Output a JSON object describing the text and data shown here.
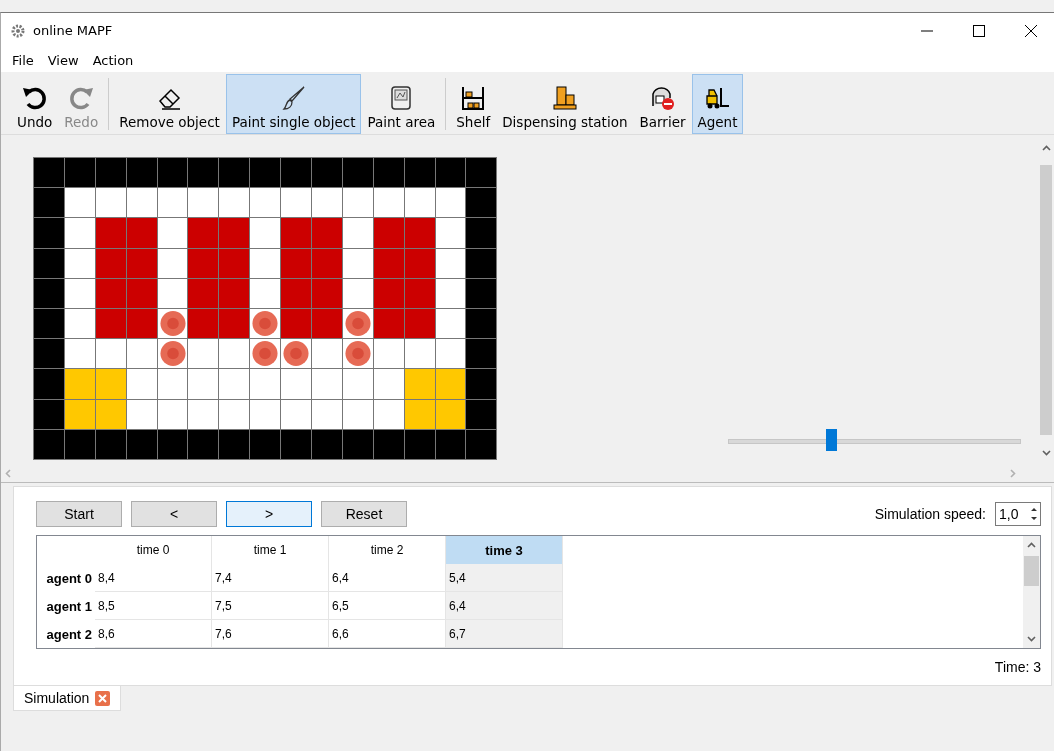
{
  "window": {
    "title": "online MAPF"
  },
  "menu": [
    "File",
    "View",
    "Action"
  ],
  "toolbar": [
    {
      "label": "Undo",
      "selected": false,
      "disabled": false
    },
    {
      "label": "Redo",
      "selected": false,
      "disabled": true
    },
    {
      "label": "Remove object",
      "selected": false,
      "disabled": false
    },
    {
      "label": "Paint single object",
      "selected": true,
      "disabled": false
    },
    {
      "label": "Paint area",
      "selected": false,
      "disabled": false
    },
    {
      "label": "Shelf",
      "selected": false,
      "disabled": false
    },
    {
      "label": "Dispensing station",
      "selected": false,
      "disabled": false
    },
    {
      "label": "Barrier",
      "selected": false,
      "disabled": false
    },
    {
      "label": "Agent",
      "selected": true,
      "disabled": false
    }
  ],
  "map": {
    "cells": [
      [
        {
          "kind": "barrier"
        },
        {
          "kind": "barrier"
        },
        {
          "kind": "barrier"
        },
        {
          "kind": "barrier"
        },
        {
          "kind": "barrier"
        },
        {
          "kind": "barrier"
        },
        {
          "kind": "barrier"
        },
        {
          "kind": "barrier"
        },
        {
          "kind": "barrier"
        },
        {
          "kind": "barrier"
        },
        {
          "kind": "barrier"
        },
        {
          "kind": "barrier"
        },
        {
          "kind": "barrier"
        },
        {
          "kind": "barrier"
        },
        {
          "kind": "barrier"
        }
      ],
      [
        {
          "kind": "barrier"
        },
        {
          "kind": "floor"
        },
        {
          "kind": "floor"
        },
        {
          "kind": "floor"
        },
        {
          "kind": "floor"
        },
        {
          "kind": "floor"
        },
        {
          "kind": "floor"
        },
        {
          "kind": "floor"
        },
        {
          "kind": "floor"
        },
        {
          "kind": "floor"
        },
        {
          "kind": "floor"
        },
        {
          "kind": "floor"
        },
        {
          "kind": "floor"
        },
        {
          "kind": "floor"
        },
        {
          "kind": "barrier"
        }
      ],
      [
        {
          "kind": "barrier"
        },
        {
          "kind": "floor"
        },
        {
          "kind": "shelf"
        },
        {
          "kind": "shelf"
        },
        {
          "kind": "floor"
        },
        {
          "kind": "shelf"
        },
        {
          "kind": "shelf"
        },
        {
          "kind": "floor"
        },
        {
          "kind": "shelf"
        },
        {
          "kind": "shelf"
        },
        {
          "kind": "floor"
        },
        {
          "kind": "shelf"
        },
        {
          "kind": "shelf"
        },
        {
          "kind": "floor"
        },
        {
          "kind": "barrier"
        }
      ],
      [
        {
          "kind": "barrier"
        },
        {
          "kind": "floor"
        },
        {
          "kind": "shelf"
        },
        {
          "kind": "shelf"
        },
        {
          "kind": "floor"
        },
        {
          "kind": "shelf"
        },
        {
          "kind": "shelf"
        },
        {
          "kind": "floor"
        },
        {
          "kind": "shelf"
        },
        {
          "kind": "shelf"
        },
        {
          "kind": "floor"
        },
        {
          "kind": "shelf"
        },
        {
          "kind": "shelf"
        },
        {
          "kind": "floor"
        },
        {
          "kind": "barrier"
        }
      ],
      [
        {
          "kind": "barrier"
        },
        {
          "kind": "floor"
        },
        {
          "kind": "shelf"
        },
        {
          "kind": "shelf"
        },
        {
          "kind": "floor"
        },
        {
          "kind": "shelf"
        },
        {
          "kind": "shelf"
        },
        {
          "kind": "floor"
        },
        {
          "kind": "shelf"
        },
        {
          "kind": "shelf"
        },
        {
          "kind": "floor"
        },
        {
          "kind": "shelf"
        },
        {
          "kind": "shelf"
        },
        {
          "kind": "floor"
        },
        {
          "kind": "barrier"
        }
      ],
      [
        {
          "kind": "barrier"
        },
        {
          "kind": "floor"
        },
        {
          "kind": "shelf"
        },
        {
          "kind": "shelf"
        },
        {
          "kind": "agent"
        },
        {
          "kind": "shelf"
        },
        {
          "kind": "shelf"
        },
        {
          "kind": "agent"
        },
        {
          "kind": "shelf"
        },
        {
          "kind": "shelf"
        },
        {
          "kind": "agent"
        },
        {
          "kind": "shelf"
        },
        {
          "kind": "shelf"
        },
        {
          "kind": "floor"
        },
        {
          "kind": "barrier"
        }
      ],
      [
        {
          "kind": "barrier"
        },
        {
          "kind": "floor"
        },
        {
          "kind": "floor"
        },
        {
          "kind": "floor"
        },
        {
          "kind": "agent"
        },
        {
          "kind": "floor"
        },
        {
          "kind": "floor"
        },
        {
          "kind": "agent"
        },
        {
          "kind": "agent"
        },
        {
          "kind": "floor"
        },
        {
          "kind": "agent"
        },
        {
          "kind": "floor"
        },
        {
          "kind": "floor"
        },
        {
          "kind": "floor"
        },
        {
          "kind": "barrier"
        }
      ],
      [
        {
          "kind": "barrier"
        },
        {
          "kind": "station"
        },
        {
          "kind": "station"
        },
        {
          "kind": "floor"
        },
        {
          "kind": "floor"
        },
        {
          "kind": "floor"
        },
        {
          "kind": "floor"
        },
        {
          "kind": "floor"
        },
        {
          "kind": "floor"
        },
        {
          "kind": "floor"
        },
        {
          "kind": "floor"
        },
        {
          "kind": "floor"
        },
        {
          "kind": "station"
        },
        {
          "kind": "station"
        },
        {
          "kind": "barrier"
        }
      ],
      [
        {
          "kind": "barrier"
        },
        {
          "kind": "station"
        },
        {
          "kind": "station"
        },
        {
          "kind": "floor"
        },
        {
          "kind": "floor"
        },
        {
          "kind": "floor"
        },
        {
          "kind": "floor"
        },
        {
          "kind": "floor"
        },
        {
          "kind": "floor"
        },
        {
          "kind": "floor"
        },
        {
          "kind": "floor"
        },
        {
          "kind": "floor"
        },
        {
          "kind": "station"
        },
        {
          "kind": "station"
        },
        {
          "kind": "barrier"
        }
      ],
      [
        {
          "kind": "barrier"
        },
        {
          "kind": "barrier"
        },
        {
          "kind": "barrier"
        },
        {
          "kind": "barrier"
        },
        {
          "kind": "barrier"
        },
        {
          "kind": "barrier"
        },
        {
          "kind": "barrier"
        },
        {
          "kind": "barrier"
        },
        {
          "kind": "barrier"
        },
        {
          "kind": "barrier"
        },
        {
          "kind": "barrier"
        },
        {
          "kind": "barrier"
        },
        {
          "kind": "barrier"
        },
        {
          "kind": "barrier"
        },
        {
          "kind": "barrier"
        }
      ]
    ],
    "zoom": {
      "level": 0.35
    }
  },
  "controls": [
    {
      "label": "Start",
      "focused": false
    },
    {
      "label": "<",
      "focused": false
    },
    {
      "label": ">",
      "focused": true
    },
    {
      "label": "Reset",
      "focused": false
    }
  ],
  "speed": {
    "label": "Simulation speed:",
    "value": "1,0"
  },
  "table": {
    "columns": [
      {
        "label": "time 0",
        "selected": false
      },
      {
        "label": "time 1",
        "selected": false
      },
      {
        "label": "time 2",
        "selected": false
      },
      {
        "label": "time 3",
        "selected": true
      }
    ],
    "rows": [
      {
        "header": "agent 0",
        "cells": [
          "8,4",
          "7,4",
          "6,4",
          "5,4"
        ]
      },
      {
        "header": "agent 1",
        "cells": [
          "8,5",
          "7,5",
          "6,5",
          "6,4"
        ]
      },
      {
        "header": "agent 2",
        "cells": [
          "8,6",
          "7,6",
          "6,6",
          "6,7"
        ]
      }
    ]
  },
  "time": "Time: 3",
  "tabs": [
    {
      "label": "Simulation",
      "selected": true
    }
  ]
}
